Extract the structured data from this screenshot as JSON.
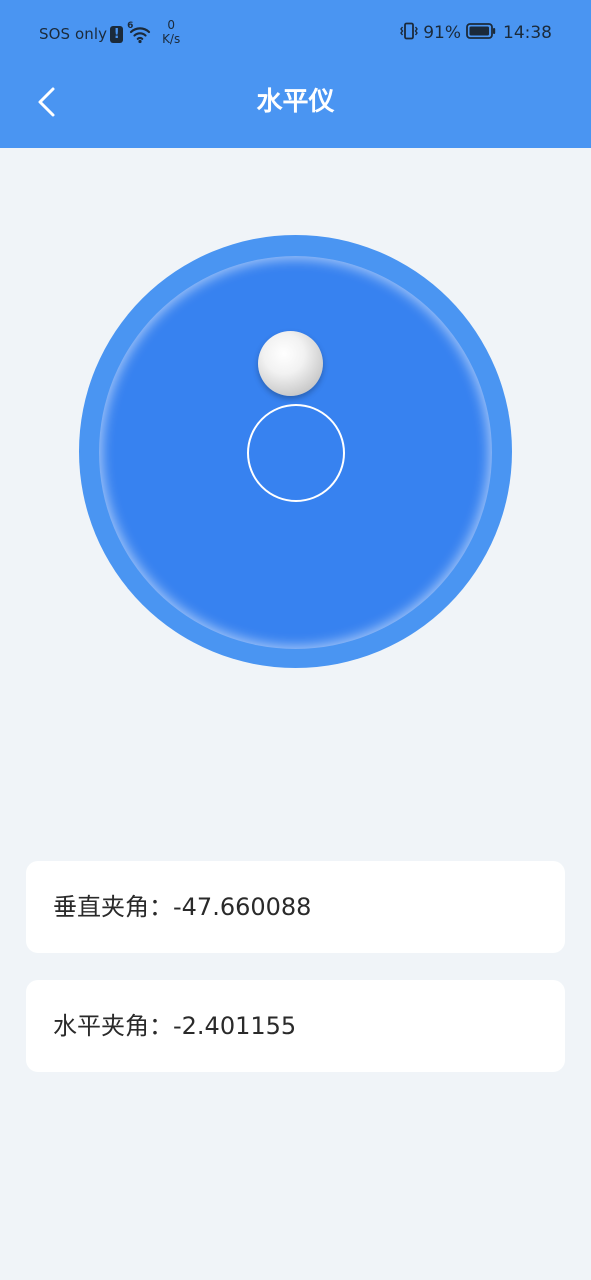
{
  "status_bar": {
    "carrier": "SOS only",
    "alert_badge": "!",
    "wifi_generation": "6",
    "net_speed_value": "0",
    "net_speed_unit": "K/s",
    "battery_percent": "91%",
    "time": "14:38"
  },
  "header": {
    "title": "水平仪",
    "back_icon": "chevron-left-icon",
    "background_color": "#4a95f2"
  },
  "level": {
    "outer_color": "#4a95f2",
    "inner_color": "#3782f0",
    "ring_color": "#ffffff"
  },
  "readings": {
    "vertical": {
      "label": "垂直夹角：",
      "value": "-47.660088"
    },
    "horizontal": {
      "label": "水平夹角：",
      "value": "-2.401155"
    }
  }
}
